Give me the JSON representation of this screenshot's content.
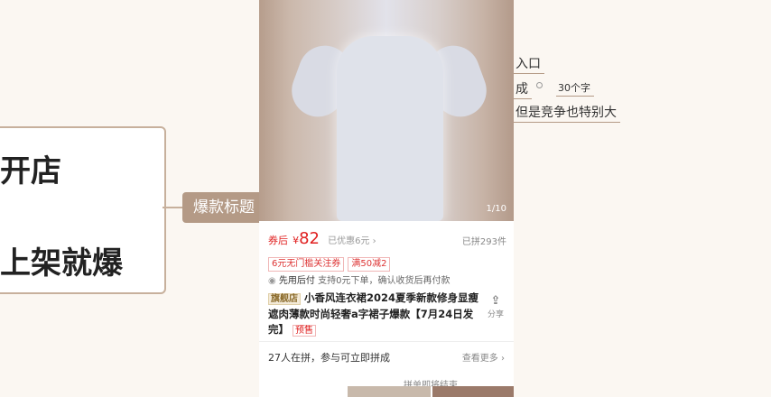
{
  "mindmap": {
    "root_line1": "开店",
    "root_line2": "上架就爆",
    "branch": "爆款标题",
    "leaf1": "入口",
    "leaf2": "成",
    "leaf2_note": "30个字",
    "leaf3": "但是竞争也特别大"
  },
  "product": {
    "image_counter": "1/10",
    "coupon_label": "券后",
    "price_symbol": "¥",
    "price": "82",
    "discount": "已优惠6元 ›",
    "sold": "已拼293件",
    "tags": [
      "6元无门槛关注券",
      "满50减2"
    ],
    "pay_label": "先用后付",
    "pay_desc": "支持0元下单，确认收货后再付款",
    "flag": "旗舰店",
    "title": "小香风连衣裙2024夏季新款修身显瘦遮肉薄款时尚轻奢a字裙子爆款【7月24日发完】",
    "presale": "预售",
    "share": "分享",
    "group_text": "27人在拼，参与可立即拼成",
    "more": "查看更多 ›",
    "bottom_status": "拼单即将结束"
  },
  "colors": {
    "accent": "#e02020",
    "mindmap_border": "#c7b09c",
    "branch_fill": "#b49a86"
  }
}
